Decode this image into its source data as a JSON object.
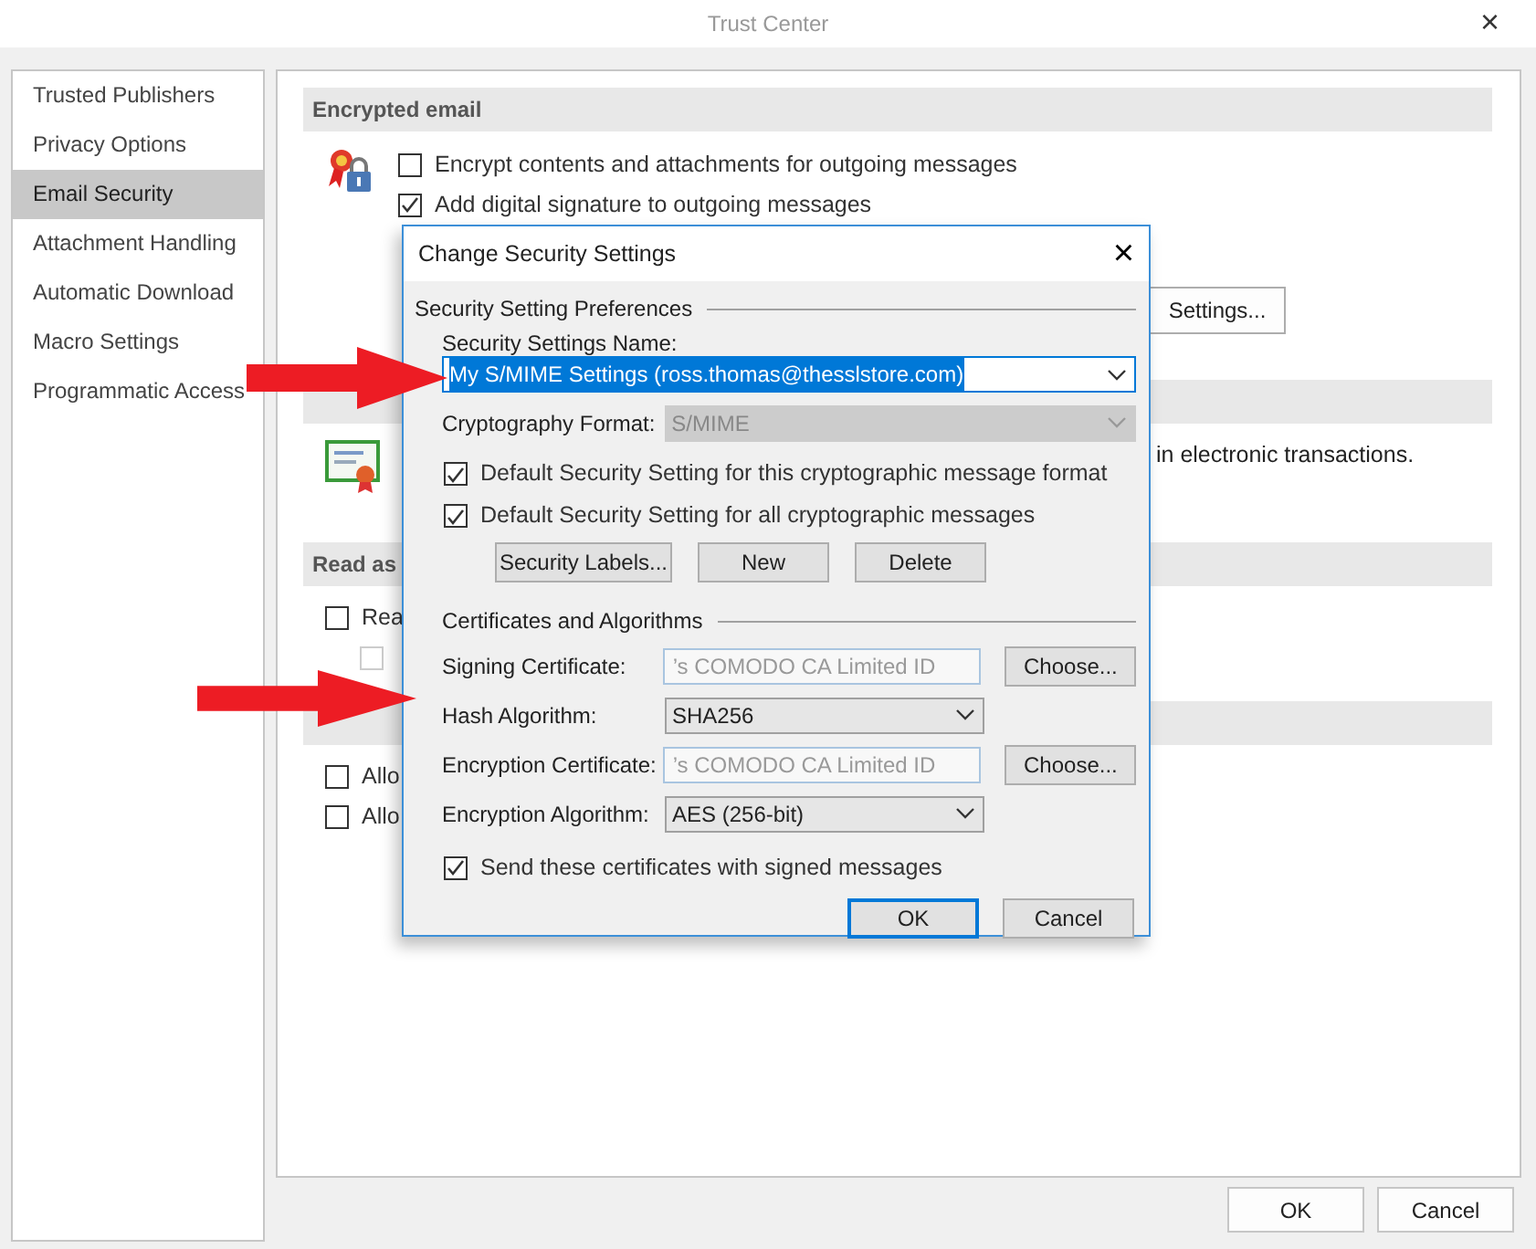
{
  "window": {
    "title": "Trust Center",
    "close": "×"
  },
  "sidebar": {
    "items": [
      {
        "label": "Trusted Publishers",
        "selected": false
      },
      {
        "label": "Privacy Options",
        "selected": false
      },
      {
        "label": "Email Security",
        "selected": true
      },
      {
        "label": "Attachment Handling",
        "selected": false
      },
      {
        "label": "Automatic Download",
        "selected": false
      },
      {
        "label": "Macro Settings",
        "selected": false
      },
      {
        "label": "Programmatic Access",
        "selected": false
      }
    ]
  },
  "sections": [
    {
      "kind": "encrypted",
      "heading": "Encrypted email",
      "options": [
        {
          "label": "Encrypt contents and attachments for outgoing messages",
          "checked": false,
          "disabled": false
        },
        {
          "label": "Add digital signature to outgoing messages",
          "checked": true,
          "disabled": false
        }
      ],
      "button": "Settings..."
    },
    {
      "kind": "digital",
      "text": "in electronic transactions."
    },
    {
      "kind": "read",
      "heading": "Read as",
      "options": [
        {
          "label": "Rea",
          "checked": false,
          "disabled": false
        },
        {
          "checked": false,
          "disabled": true
        }
      ]
    },
    {
      "kind": "script",
      "options": [
        {
          "label": "Allo",
          "checked": false,
          "disabled": false
        },
        {
          "label": "Allo",
          "checked": false,
          "disabled": false
        }
      ]
    }
  ],
  "footer_buttons": [
    {
      "label": "OK"
    },
    {
      "label": "Cancel"
    }
  ],
  "dialog": {
    "title": "Change Security Settings",
    "close": "×",
    "preferences": {
      "heading": "Security Setting Preferences",
      "name_label": "Security Settings Name:",
      "name_value": "My S/MIME Settings (ross.thomas@thesslstore.com)",
      "name_text_selected": true,
      "format_label": "Cryptography Format:",
      "format_value": "S/MIME",
      "format_disabled": true,
      "defaults": [
        {
          "label": "Default Security Setting for this cryptographic message format",
          "checked": true
        },
        {
          "label": "Default Security Setting for all cryptographic messages",
          "checked": true
        }
      ],
      "buttons": [
        "Security Labels...",
        "New",
        "Delete"
      ]
    },
    "certificates": {
      "heading": "Certificates and Algorithms",
      "rows": [
        {
          "kind": "certificate",
          "label": "Signing Certificate:",
          "value": "’s COMODO CA Limited ID",
          "button": "Choose..."
        },
        {
          "kind": "select",
          "label": "Hash Algorithm:",
          "value": "SHA256"
        },
        {
          "kind": "certificate",
          "label": "Encryption Certificate:",
          "value": "’s COMODO CA Limited ID",
          "button": "Choose..."
        },
        {
          "kind": "select",
          "label": "Encryption Algorithm:",
          "value": "AES (256-bit)"
        }
      ],
      "send_option": {
        "label": "Send these certificates with signed messages",
        "checked": true
      }
    },
    "buttons": [
      {
        "label": "OK",
        "default": true
      },
      {
        "label": "Cancel",
        "default": false
      }
    ]
  }
}
